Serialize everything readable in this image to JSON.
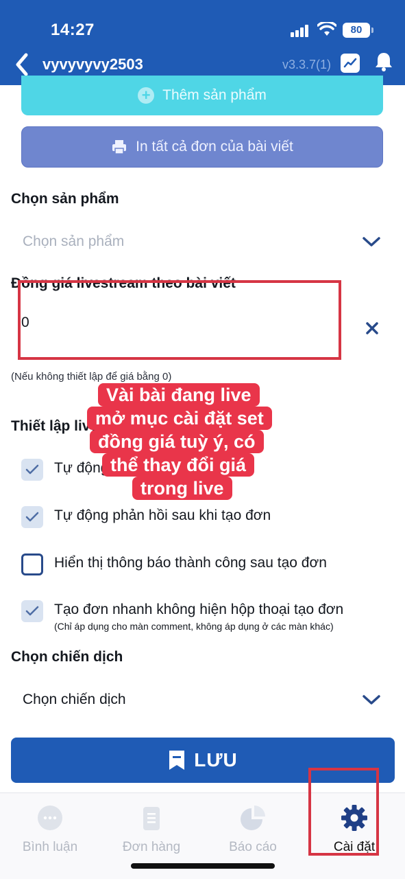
{
  "status_bar": {
    "time": "14:27",
    "battery": "80",
    "icons": [
      "signal-icon",
      "wifi-icon",
      "battery-icon"
    ]
  },
  "nav": {
    "title": "vyvyvyvy2503",
    "version": "v3.3.7(1)",
    "icons": [
      "back-icon",
      "chart-icon",
      "bell-icon"
    ]
  },
  "actions": {
    "add_product_label": "Thêm sản phẩm",
    "print_all_label": "In tất cả đơn của bài viết"
  },
  "product_select": {
    "label": "Chọn sản phẩm",
    "placeholder": "Chọn sản phẩm"
  },
  "livestream_price": {
    "label": "Đồng giá livestream theo bài viết",
    "value": "0",
    "note": "(Nếu không thiết lập để giá bằng 0)"
  },
  "live_settings": {
    "label": "Thiết lập live",
    "options": [
      {
        "label": "Tự động",
        "checked": true
      },
      {
        "label": "Tự động phản hồi sau khi tạo đơn",
        "checked": true
      },
      {
        "label": "Hiển thị thông báo thành công sau tạo đơn",
        "checked": false
      },
      {
        "label": "Tạo đơn nhanh không hiện hộp thoại tạo đơn",
        "sublabel": "(Chỉ áp dụng cho màn comment, không áp dụng ở các màn khác)",
        "checked": true
      }
    ]
  },
  "campaign_select": {
    "label": "Chọn chiến dịch",
    "value": "Chọn chiến dịch"
  },
  "save_label": "LƯU",
  "caption": {
    "lines": [
      "Vài bài đang live",
      "mở mục cài đặt set",
      "đồng giá tuỳ ý, có",
      "thể thay đổi giá",
      "trong live"
    ]
  },
  "tabs": [
    {
      "label": "Bình luận",
      "icon": "chat-icon",
      "active": false
    },
    {
      "label": "Đơn hàng",
      "icon": "order-icon",
      "active": false
    },
    {
      "label": "Báo cáo",
      "icon": "pie-chart-icon",
      "active": false
    },
    {
      "label": "Cài đặt",
      "icon": "gear-icon",
      "active": true
    }
  ],
  "colors": {
    "primary": "#1f5bb5",
    "cyan_button": "#4fd6e6",
    "print_button": "#6f86cf",
    "caption_bg": "#e9354a",
    "highlight_border": "#d63544"
  }
}
